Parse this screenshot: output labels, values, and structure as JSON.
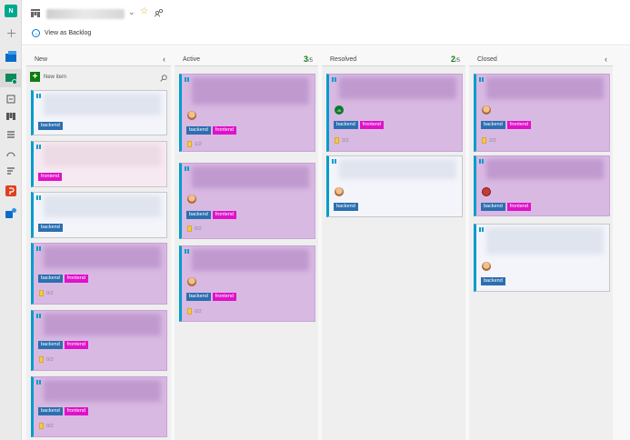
{
  "rail": {
    "org_initial": "N"
  },
  "header": {
    "view_backlog": "View as Backlog"
  },
  "board": {
    "new_item_label": "New item",
    "tags": {
      "backend": "backend",
      "frontend": "frontend"
    },
    "columns": [
      {
        "title": "New"
      },
      {
        "title": "Active",
        "count": "3",
        "limit": "/5"
      },
      {
        "title": "Resolved",
        "count": "2",
        "limit": "/5"
      },
      {
        "title": "Closed"
      }
    ],
    "tasks": {
      "new_4": "0/2",
      "new_5": "0/2",
      "new_6": "0/2",
      "active_1": "1/2",
      "active_2": "0/2",
      "active_3": "0/2",
      "resolved_1": "2/2",
      "closed_1": "2/2"
    },
    "initials": {
      "resolved_1": "JK"
    }
  },
  "colors": {
    "accent": "#009ccc",
    "backend_tag": "#2c6fb0",
    "frontend_tag": "#e012c9",
    "card_purple": "#d8b9e2",
    "count_green": "#107c10"
  }
}
